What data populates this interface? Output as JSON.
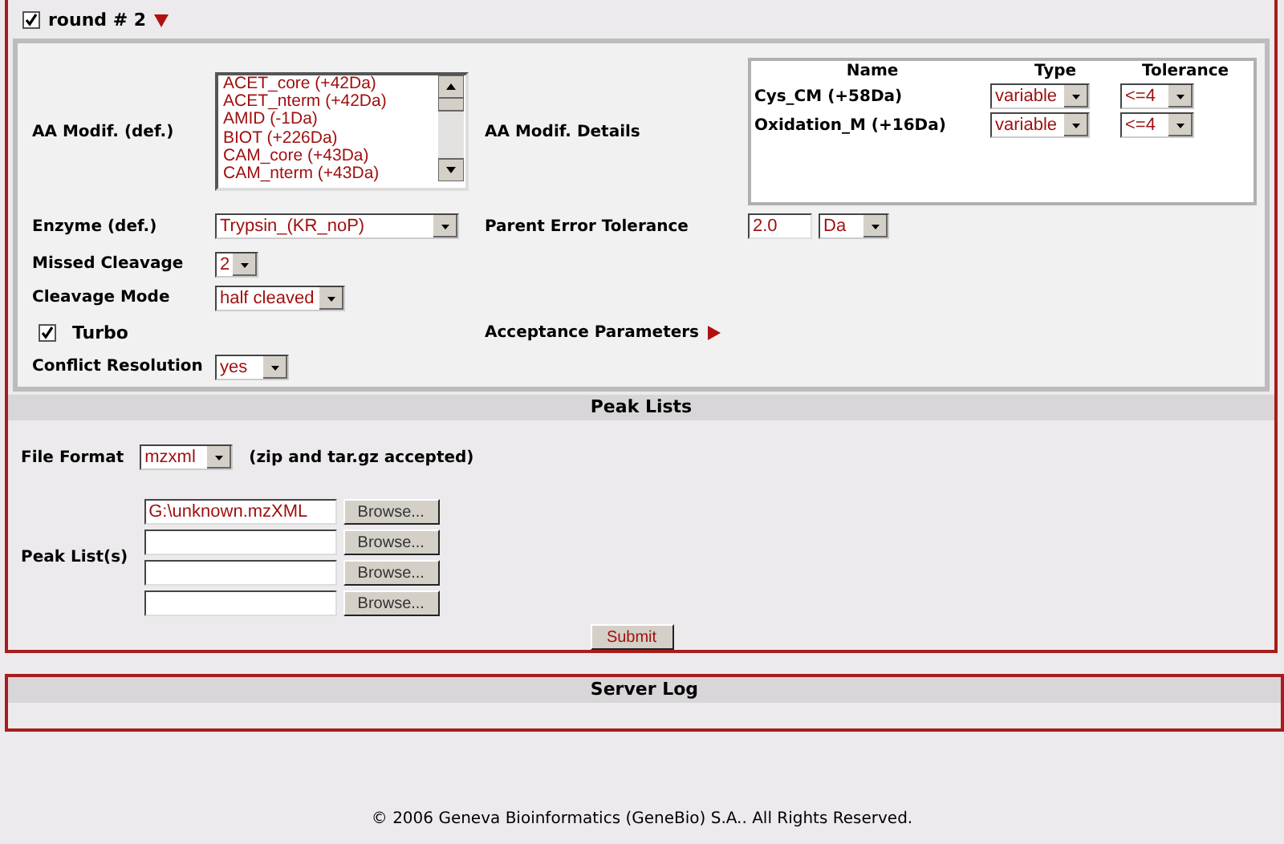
{
  "round": {
    "label": "round # 2",
    "checked": true,
    "expanded": true
  },
  "aa_modif": {
    "label": "AA Modif. (def.)",
    "options": [
      "ACET_core (+42Da)",
      "ACET_nterm (+42Da)",
      "AMID (-1Da)",
      "BIOT (+226Da)",
      "CAM_core (+43Da)",
      "CAM_nterm (+43Da)"
    ]
  },
  "aa_details": {
    "label": "AA Modif. Details",
    "columns": [
      "Name",
      "Type",
      "Tolerance"
    ],
    "rows": [
      {
        "name": "Cys_CM (+58Da)",
        "type": "variable",
        "tolerance": "<=4"
      },
      {
        "name": "Oxidation_M (+16Da)",
        "type": "variable",
        "tolerance": "<=4"
      }
    ]
  },
  "enzyme": {
    "label": "Enzyme (def.)",
    "value": "Trypsin_(KR_noP)"
  },
  "parent_error": {
    "label": "Parent Error Tolerance",
    "value": "2.0",
    "unit": "Da"
  },
  "missed_cleavage": {
    "label": "Missed Cleavage",
    "value": "2"
  },
  "cleavage_mode": {
    "label": "Cleavage Mode",
    "value": "half cleaved"
  },
  "turbo": {
    "label": "Turbo",
    "checked": true
  },
  "acceptance": {
    "label": "Acceptance Parameters",
    "expanded": false
  },
  "conflict": {
    "label": "Conflict Resolution",
    "value": "yes"
  },
  "peak_lists": {
    "title": "Peak Lists",
    "file_format": {
      "label": "File Format",
      "value": "mzxml",
      "note": "(zip and tar.gz accepted)"
    },
    "label": "Peak List(s)",
    "files": [
      {
        "value": "G:\\unknown.mzXML",
        "button": "Browse..."
      },
      {
        "button": "Browse..."
      },
      {
        "button": "Browse..."
      },
      {
        "button": "Browse..."
      }
    ],
    "submit": "Submit"
  },
  "server_log": {
    "title": "Server Log"
  },
  "footer": "© 2006 Geneva Bioinformatics (GeneBio) S.A.. All Rights Reserved."
}
